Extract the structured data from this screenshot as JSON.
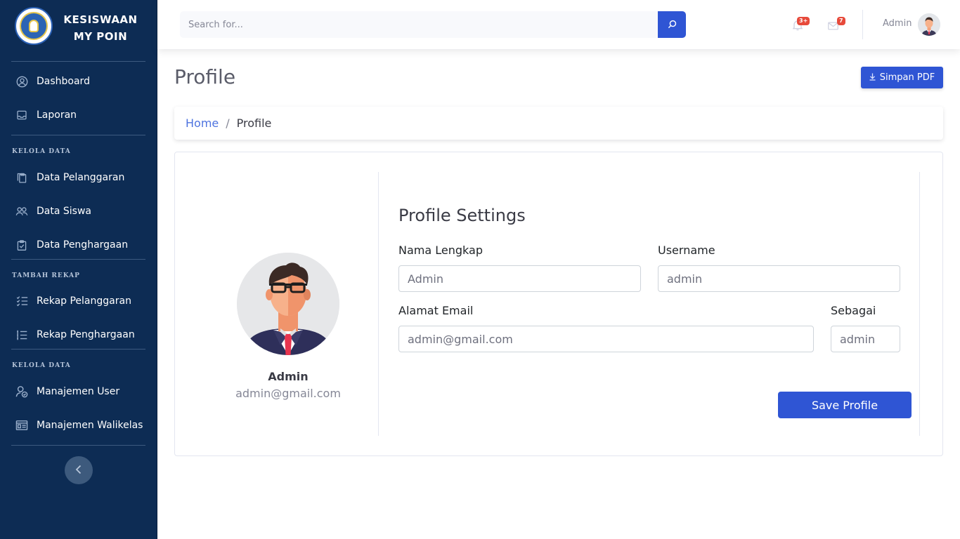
{
  "brand": {
    "line1": "KESISWAAN",
    "line2": "MY POIN"
  },
  "sidebar": {
    "items": [
      {
        "label": "Dashboard",
        "icon": "user-circle-icon"
      },
      {
        "label": "Laporan",
        "icon": "inbox-icon"
      },
      {
        "label": "Data Pelanggaran",
        "icon": "clipboard-copy-icon"
      },
      {
        "label": "Data Siswa",
        "icon": "users-icon"
      },
      {
        "label": "Data Penghargaan",
        "icon": "clipboard-check-icon"
      },
      {
        "label": "Rekap Pelanggaran",
        "icon": "checklist-icon"
      },
      {
        "label": "Rekap Penghargaan",
        "icon": "list-icon"
      },
      {
        "label": "Manajemen User",
        "icon": "user-check-icon"
      },
      {
        "label": "Manajemen Walikelas",
        "icon": "id-card-icon"
      }
    ],
    "headings": [
      "KELOLA DATA",
      "TAMBAH REKAP",
      "KELOLA DATA"
    ]
  },
  "topbar": {
    "search_placeholder": "Search for...",
    "notifications_badge": "3+",
    "messages_badge": "7",
    "user_name": "Admin"
  },
  "page": {
    "title": "Profile",
    "pdf_button": "Simpan PDF"
  },
  "breadcrumb": {
    "home": "Home",
    "separator": "/",
    "current": "Profile"
  },
  "profile": {
    "name": "Admin",
    "email": "admin@gmail.com"
  },
  "settings": {
    "title": "Profile Settings",
    "nama_label": "Nama Lengkap",
    "nama_value": "Admin",
    "username_label": "Username",
    "username_value": "admin",
    "email_label": "Alamat Email",
    "email_value": "admin@gmail.com",
    "role_label": "Sebagai",
    "role_value": "admin",
    "save_button": "Save Profile"
  },
  "colors": {
    "sidebar": "#0d2c54",
    "primary": "#2f55d4",
    "badge": "#e74a3b"
  }
}
